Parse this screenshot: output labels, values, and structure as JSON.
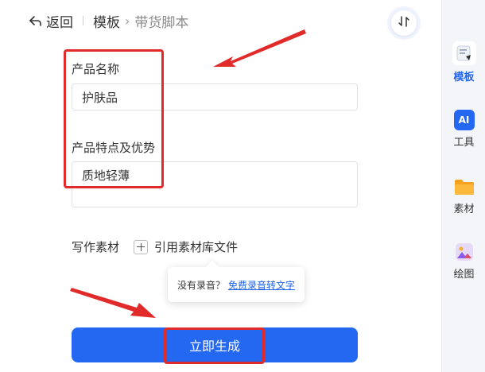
{
  "header": {
    "back_label": "返回",
    "breadcrumb_root": "模板",
    "breadcrumb_separator": "›",
    "breadcrumb_current": "带货脚本"
  },
  "form": {
    "product_name_label": "产品名称",
    "product_name_value": "护肤品",
    "product_features_label": "产品特点及优势",
    "product_features_value": "质地轻薄",
    "material_label": "写作素材",
    "add_material_label": "引用素材库文件"
  },
  "tooltip": {
    "text": "没有录音？",
    "link": "免费录音转文字"
  },
  "generate_button_label": "立即生成",
  "sidebar": {
    "items": [
      {
        "label": "模板",
        "icon": "template-icon",
        "active": true
      },
      {
        "label": "工具",
        "icon": "ai-tool-icon",
        "badge": "AI",
        "active": false
      },
      {
        "label": "素材",
        "icon": "folder-icon",
        "active": false
      },
      {
        "label": "绘图",
        "icon": "image-icon",
        "active": false
      }
    ]
  },
  "colors": {
    "accent": "#2468f2",
    "annotation": "#e12a2a"
  }
}
